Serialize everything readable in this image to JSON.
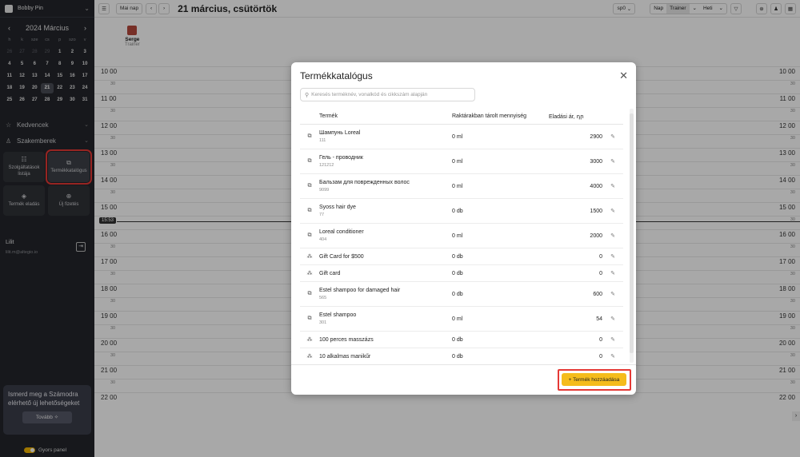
{
  "sidebar": {
    "user": "Bobby Pin",
    "calendar": {
      "month": "2024 Március",
      "weekdays": [
        "h",
        "k",
        "sze",
        "cs",
        "p",
        "szo",
        "v"
      ],
      "days": [
        [
          "26",
          "27",
          "28",
          "29",
          "1",
          "2",
          "3"
        ],
        [
          "4",
          "5",
          "6",
          "7",
          "8",
          "9",
          "10"
        ],
        [
          "11",
          "12",
          "13",
          "14",
          "15",
          "16",
          "17"
        ],
        [
          "18",
          "19",
          "20",
          "21",
          "22",
          "23",
          "24"
        ],
        [
          "25",
          "26",
          "27",
          "28",
          "29",
          "30",
          "31"
        ]
      ],
      "today": "21"
    },
    "favorites": "Kedvencek",
    "specialists": "Szakemberek",
    "tiles": [
      {
        "label": "Szolgáltatások listája",
        "icon": "list-icon"
      },
      {
        "label": "Termékkatalógus",
        "icon": "catalog-icon"
      },
      {
        "label": "Termék eladás",
        "icon": "tag-icon"
      },
      {
        "label": "Új fizetés",
        "icon": "payment-icon"
      }
    ],
    "account": {
      "name": "Lilit",
      "email": "lilit.m@altegio.io"
    },
    "promo": {
      "text": "Ismerd meg a Számodra elérhető új lehetőségeket",
      "button": "Tovább"
    },
    "quick_panel": "Gyors panel"
  },
  "toolbar": {
    "today": "Mai nap",
    "date": "21 március, csütörtök",
    "filter": "sp0",
    "view_day": "Nap",
    "view_role": "Trainer",
    "view_week": "Heti"
  },
  "staff": {
    "name": "Serge",
    "role": "Trainer"
  },
  "times": [
    "10",
    "11",
    "12",
    "13",
    "14",
    "15",
    "16",
    "17",
    "18",
    "19",
    "20",
    "21",
    "22"
  ],
  "now": "15:53",
  "modal": {
    "title": "Termékkatalógus",
    "search_placeholder": "Keresés terméknév, vonalkód és cikkszám alapján",
    "columns": {
      "product": "Termék",
      "stock": "Raktárakban tárolt mennyiség",
      "price": "Eladási ár, դր"
    },
    "rows": [
      {
        "name": "Шампунь Loreal",
        "sku": "111",
        "stock": "0 ml",
        "price": "2900",
        "type": "product"
      },
      {
        "name": "Гель - проводник",
        "sku": "121212",
        "stock": "0 ml",
        "price": "3000",
        "type": "product"
      },
      {
        "name": "Бальзам для поврежденных волос",
        "sku": "9099",
        "stock": "0 ml",
        "price": "4000",
        "type": "product"
      },
      {
        "name": "Syoss hair dye",
        "sku": "77",
        "stock": "0 db",
        "price": "1500",
        "type": "product"
      },
      {
        "name": "Loreal conditioner",
        "sku": "404",
        "stock": "0 ml",
        "price": "2000",
        "type": "product"
      },
      {
        "name": "Gift Card for $500",
        "sku": "",
        "stock": "0 db",
        "price": "0",
        "type": "set"
      },
      {
        "name": "Gift card",
        "sku": "",
        "stock": "0 db",
        "price": "0",
        "type": "set"
      },
      {
        "name": "Estel shampoo for damaged hair",
        "sku": "565",
        "stock": "0 db",
        "price": "600",
        "type": "product"
      },
      {
        "name": "Estel shampoo",
        "sku": "301",
        "stock": "0 ml",
        "price": "54",
        "type": "product"
      },
      {
        "name": "100 perces masszázs",
        "sku": "",
        "stock": "0 db",
        "price": "0",
        "type": "set"
      },
      {
        "name": "10 alkalmas manikűr",
        "sku": "",
        "stock": "0 db",
        "price": "0",
        "type": "set"
      }
    ],
    "add_button": "+ Termék hozzáadása"
  }
}
